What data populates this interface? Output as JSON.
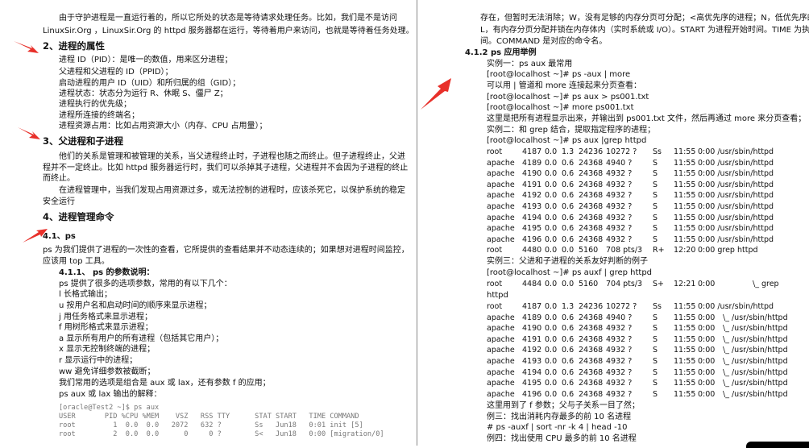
{
  "left": {
    "intro": [
      "由于守护进程是一直运行着的，所以它所处的状态是等待请求处理任务。比如，我们是不是访问",
      "LinuxSir.Org ，LinuxSir.Org 的 httpd 服务器都在运行，等待着用户来访问，也就是等待着任务处理。"
    ],
    "h2": "2、进程的属性",
    "attrs": [
      "进程 ID（PID）：是唯一的数值，用来区分进程；",
      "父进程和父进程的 ID（PPID）；",
      "启动进程的用户 ID（UID）和所归属的组（GID）；",
      "进程状态：状态分为运行 R、休眠 S、僵尸 Z；",
      "进程执行的优先级；",
      "进程所连接的终端名；",
      "进程资源占用：比如占用资源大小（内存、CPU 占用量）；"
    ],
    "h3": "3、父进程和子进程",
    "p3": [
      "他们的关系是管理和被管理的关系，当父进程终止时，子进程也随之而终止。但子进程终止，父进",
      "程并不一定终止。比如 httpd 服务器运行时，我们可以杀掉其子进程，父进程并不会因为子进程的终止",
      "而终止。",
      "在进程管理中，当我们发现占用资源过多，或无法控制的进程时，应该杀死它，以保护系统的稳定",
      "安全运行"
    ],
    "h4": "4、进程管理命令",
    "h41": "4.1、ps",
    "p41": [
      "ps 为我们提供了进程的一次性的查看，它所提供的查看结果并不动态连续的；如果想对进程时间监控，",
      "应该用 top 工具。"
    ],
    "h411": "4.1.1、 ps 的参数说明：",
    "opts": [
      "ps 提供了很多的选项参数，常用的有以下几个：",
      "l   长格式输出；",
      "u   按用户名和启动时间的顺序来显示进程；",
      "j   用任务格式来显示进程；",
      "f   用树形格式来显示进程；",
      "a   显示所有用户的所有进程（包括其它用户）；",
      "x   显示无控制终端的进程；",
      "r   显示运行中的进程；",
      "ww  避免详细参数被截断；",
      "我们常用的选项是组合是 aux 或 lax，还有参数 f 的应用；",
      "ps aux 或 lax 输出的解释："
    ],
    "code": [
      "[oracle@Test2 ~]$ ps aux",
      "USER       PID %CPU %MEM    VSZ   RSS TTY      STAT START   TIME COMMAND",
      "root         1  0.0  0.0   2072   632 ?        Ss   Jun18   0:01 init [5]",
      "root         2  0.0  0.0      0     0 ?        S<   Jun18   0:00 [migration/0]"
    ]
  },
  "right": {
    "cont": [
      "存在，但暂时无法消除；W，没有足够的内存分页可分配；<高优先序的进程；N，低优先序的进程；",
      "L，有内存分页分配并锁在内存体内（实时系统或 I/O）。START 为进程开始时间。TIME 为执行的时",
      "间。COMMAND 是对应的命令名。"
    ],
    "h412": "4.1.2 ps  应用举例",
    "ex": [
      "实例一：ps aux 最常用",
      "[root@localhost ~]# ps -aux | more",
      "可以用 | 管道和 more 连接起来分页查看：",
      "[root@localhost ~]# ps   aux  > ps001.txt",
      "[root@localhost ~]# more ps001.txt",
      "这里是把所有进程显示出来，并输出到 ps001.txt 文件，然后再通过 more 来分页查看；",
      "实例二：和 grep 结合，提取指定程序的进程；",
      "[root@localhost ~]# ps aux |grep httpd"
    ],
    "table1": [
      [
        "root",
        "4187",
        "0.0",
        "1.3",
        "24236",
        "10272 ?",
        "Ss",
        "11:55",
        "0:00 /usr/sbin/httpd"
      ],
      [
        "apache",
        "4189",
        "0.0",
        "0.6",
        "24368",
        "4940 ?",
        "S",
        "11:55",
        "0:00 /usr/sbin/httpd"
      ],
      [
        "apache",
        "4190",
        "0.0",
        "0.6",
        "24368",
        "4932 ?",
        "S",
        "11:55",
        "0:00 /usr/sbin/httpd"
      ],
      [
        "apache",
        "4191",
        "0.0",
        "0.6",
        "24368",
        "4932 ?",
        "S",
        "11:55",
        "0:00 /usr/sbin/httpd"
      ],
      [
        "apache",
        "4192",
        "0.0",
        "0.6",
        "24368",
        "4932 ?",
        "S",
        "11:55",
        "0:00 /usr/sbin/httpd"
      ],
      [
        "apache",
        "4193",
        "0.0",
        "0.6",
        "24368",
        "4932 ?",
        "S",
        "11:55",
        "0:00 /usr/sbin/httpd"
      ],
      [
        "apache",
        "4194",
        "0.0",
        "0.6",
        "24368",
        "4932 ?",
        "S",
        "11:55",
        "0:00 /usr/sbin/httpd"
      ],
      [
        "apache",
        "4195",
        "0.0",
        "0.6",
        "24368",
        "4932 ?",
        "S",
        "11:55",
        "0:00 /usr/sbin/httpd"
      ],
      [
        "apache",
        "4196",
        "0.0",
        "0.6",
        "24368",
        "4932 ?",
        "S",
        "11:55",
        "0:00 /usr/sbin/httpd"
      ],
      [
        "root",
        "4480",
        "0.0",
        "0.0",
        "5160",
        "708 pts/3",
        "R+",
        "12:20",
        "0:00 grep httpd"
      ]
    ],
    "ex3": "实例三：父进和子进程的关系友好判断的例子",
    "ex3_cmd": "[root@localhost ~]# ps auxf    | grep httpd",
    "table2_first": [
      "root",
      "4484",
      "0.0",
      "0.0",
      "5160",
      "704 pts/3",
      "S+",
      "12:21",
      "0:00",
      "\\_ grep"
    ],
    "table2_wrap": "httpd",
    "table2": [
      [
        "root",
        "4187",
        "0.0",
        "1.3",
        "24236",
        "10272 ?",
        "Ss",
        "11:55",
        "0:00 /usr/sbin/httpd"
      ],
      [
        "apache",
        "4189",
        "0.0",
        "0.6",
        "24368",
        "4940 ?",
        "S",
        "11:55",
        "0:00",
        "\\_ /usr/sbin/httpd"
      ],
      [
        "apache",
        "4190",
        "0.0",
        "0.6",
        "24368",
        "4932 ?",
        "S",
        "11:55",
        "0:00",
        "\\_ /usr/sbin/httpd"
      ],
      [
        "apache",
        "4191",
        "0.0",
        "0.6",
        "24368",
        "4932 ?",
        "S",
        "11:55",
        "0:00",
        "\\_ /usr/sbin/httpd"
      ],
      [
        "apache",
        "4192",
        "0.0",
        "0.6",
        "24368",
        "4932 ?",
        "S",
        "11:55",
        "0:00",
        "\\_ /usr/sbin/httpd"
      ],
      [
        "apache",
        "4193",
        "0.0",
        "0.6",
        "24368",
        "4932 ?",
        "S",
        "11:55",
        "0:00",
        "\\_ /usr/sbin/httpd"
      ],
      [
        "apache",
        "4194",
        "0.0",
        "0.6",
        "24368",
        "4932 ?",
        "S",
        "11:55",
        "0:00",
        "\\_ /usr/sbin/httpd"
      ],
      [
        "apache",
        "4195",
        "0.0",
        "0.6",
        "24368",
        "4932 ?",
        "S",
        "11:55",
        "0:00",
        "\\_ /usr/sbin/httpd"
      ],
      [
        "apache",
        "4196",
        "0.0",
        "0.6",
        "24368",
        "4932 ?",
        "S",
        "11:55",
        "0:00",
        "\\_ /usr/sbin/httpd"
      ]
    ],
    "tail": [
      "这里用到了 f 参数；父与子关系一目了然；",
      "例三：找出消耗内存最多的前 10 名进程",
      "# ps -auxf | sort -nr -k 4 | head -10",
      "例四：找出使用 CPU 最多的前 10 名进程"
    ]
  },
  "colors": {
    "arrow": "#e8302a",
    "divider": "#888888",
    "code": "#777777"
  }
}
